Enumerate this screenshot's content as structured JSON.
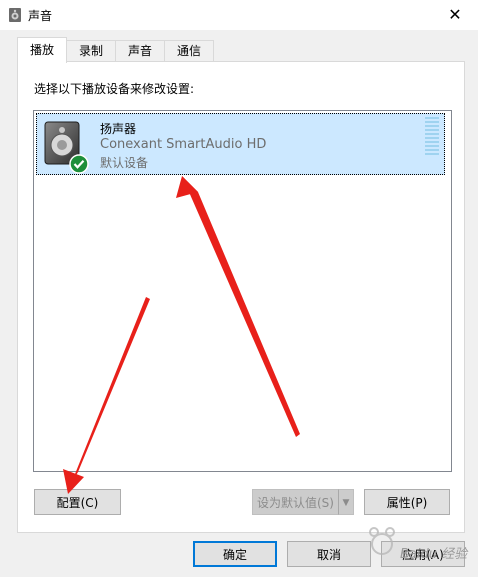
{
  "window": {
    "title": "声音",
    "close_glyph": "✕",
    "title_icon": "speaker-icon"
  },
  "tabs": [
    {
      "label": "播放",
      "active": true
    },
    {
      "label": "录制",
      "active": false
    },
    {
      "label": "声音",
      "active": false
    },
    {
      "label": "通信",
      "active": false
    }
  ],
  "instruction": "选择以下播放设备来修改设置:",
  "device": {
    "name": "扬声器",
    "driver": "Conexant SmartAudio HD",
    "status": "默认设备",
    "icon": "speaker-icon",
    "status_icon": "checkmark-icon"
  },
  "buttons": {
    "configure": "配置(C)",
    "set_default": "设为默认值(S)",
    "properties": "属性(P)",
    "ok": "确定",
    "cancel": "取消",
    "apply": "应用(A)"
  },
  "watermark": {
    "text": "Baidu 经验"
  },
  "colors": {
    "selection": "#cce8ff",
    "arrow": "#e8201a",
    "check": "#1e8f3a"
  }
}
